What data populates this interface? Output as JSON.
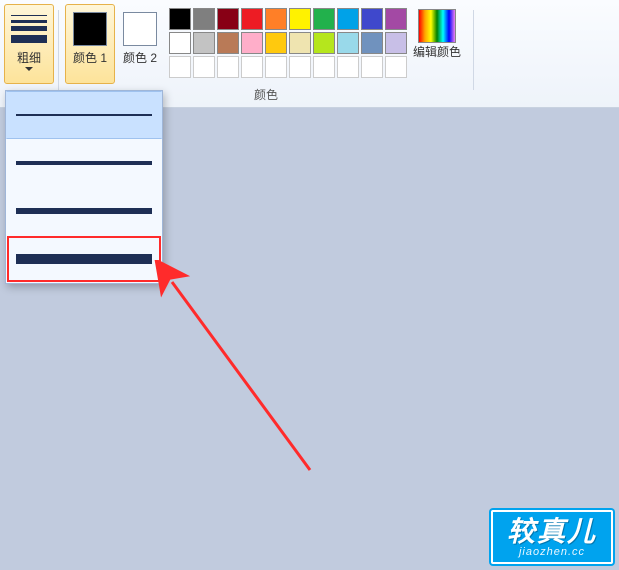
{
  "ribbon": {
    "thickness": {
      "label": "粗细"
    },
    "color1": {
      "label": "颜色 1",
      "value": "#000000"
    },
    "color2": {
      "label": "颜色 2",
      "value": "#ffffff"
    },
    "edit_colors": {
      "label": "编辑颜色"
    },
    "colors_group_label": "颜色",
    "palette": {
      "row1": [
        "#000000",
        "#7f7f7f",
        "#880015",
        "#ed1c24",
        "#ff7f27",
        "#fff200",
        "#22b14c",
        "#00a2e8",
        "#3f48cc",
        "#a349a4"
      ],
      "row2": [
        "#ffffff",
        "#c3c3c3",
        "#b97a57",
        "#ffaec9",
        "#ffc90e",
        "#efe4b0",
        "#b5e61d",
        "#99d9ea",
        "#7092be",
        "#c8bfe7"
      ],
      "row3_empty_count": 10
    }
  },
  "thickness_dropdown": {
    "options": [
      {
        "id": "thickness-1px",
        "weight": "1px"
      },
      {
        "id": "thickness-3px",
        "weight": "3px"
      },
      {
        "id": "thickness-5px",
        "weight": "5px"
      },
      {
        "id": "thickness-8px",
        "weight": "8px"
      }
    ],
    "hovered_index": 0,
    "annotated_index": 3
  },
  "watermark": {
    "title": "较真儿",
    "subtitle": "jiaozhen.cc"
  }
}
